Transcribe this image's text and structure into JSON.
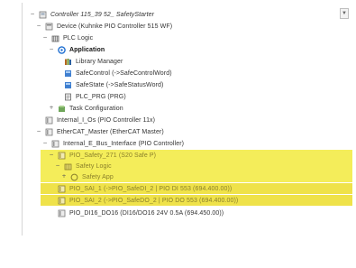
{
  "tree": {
    "controller": "Controller 115_39 52_ SafetyStarter",
    "device": "Device (Kuhnke PIO Controller 515 WF)",
    "plc_logic": "PLC Logic",
    "application": "Application",
    "library_manager": "Library Manager",
    "safe_control": "SafeControl (->SafeControlWord)",
    "safe_state": "SafeState (->SafeStatusWord)",
    "plc_prg": "PLC_PRG (PRG)",
    "task_config": "Task Configuration",
    "internal_io": "Internal_I_Os (PIO Controller 11x)",
    "ethercat_master": "EtherCAT_Master (EtherCAT Master)",
    "internal_ebus": "Internal_E_Bus_Interface (PIO Controller)",
    "pio_safety": "PIO_Safety_271 (S20 Safe P)",
    "safety_logic": "Safety Logic",
    "safety_app": "Safety App",
    "pio_sai_1": "PIO_SAI_1 (->PIO_SafeDI_2 | PIO DI 553 (694.400.00))",
    "pio_sai_2": "PIO_SAI_2 (->PIO_SafeDO_2 | PIO DO 553 (694.400.00))",
    "pio_di16": "PIO_DI16_DO16 (DI16/DO16 24V 0.5A (694.450.00))"
  },
  "icons": {
    "controller": "controller-icon",
    "device": "device-icon",
    "plc": "plc-logic-icon",
    "application": "application-icon",
    "library": "library-icon",
    "variable": "variable-icon",
    "program": "program-icon",
    "task": "task-icon",
    "io": "io-module-icon"
  },
  "colors": {
    "highlight": "#f4ed5a",
    "highlight_dark": "#efe24a",
    "application_icon": "#1f6fd1"
  }
}
